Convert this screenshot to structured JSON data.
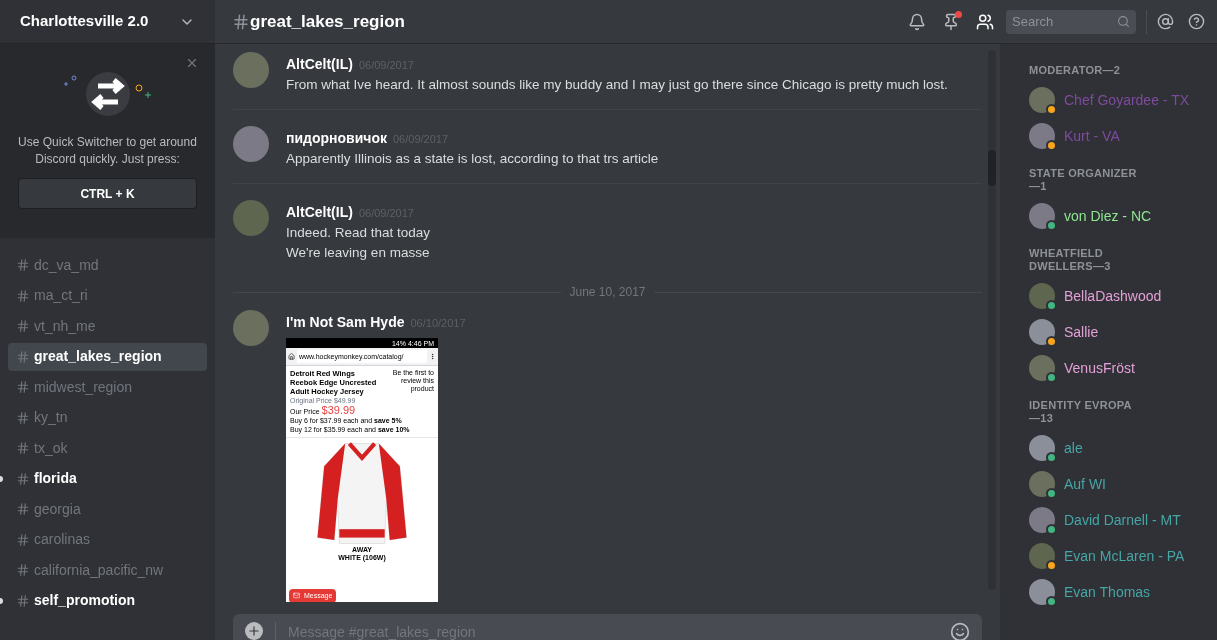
{
  "server": {
    "name": "Charlottesville 2.0"
  },
  "quick_switcher": {
    "text": "Use Quick Switcher to get around Discord quickly. Just press:",
    "shortcut": "CTRL + K"
  },
  "channels": [
    {
      "name": "dc_va_md",
      "selected": false,
      "unread": false
    },
    {
      "name": "ma_ct_ri",
      "selected": false,
      "unread": false
    },
    {
      "name": "vt_nh_me",
      "selected": false,
      "unread": false
    },
    {
      "name": "great_lakes_region",
      "selected": true,
      "unread": false
    },
    {
      "name": "midwest_region",
      "selected": false,
      "unread": false
    },
    {
      "name": "ky_tn",
      "selected": false,
      "unread": false
    },
    {
      "name": "tx_ok",
      "selected": false,
      "unread": false
    },
    {
      "name": "florida",
      "selected": false,
      "unread": true
    },
    {
      "name": "georgia",
      "selected": false,
      "unread": false
    },
    {
      "name": "carolinas",
      "selected": false,
      "unread": false
    },
    {
      "name": "california_pacific_nw",
      "selected": false,
      "unread": false
    },
    {
      "name": "self_promotion",
      "selected": false,
      "unread": true
    }
  ],
  "header": {
    "channel": "great_lakes_region",
    "search_placeholder": "Search",
    "pins_unread": true
  },
  "messages": [
    {
      "kind": "group",
      "author": "AltCelt(IL)",
      "time": "06/09/2017",
      "lines": [
        "From what Ive heard. It almost sounds like my buddy and I may just go there since Chicago is pretty much lost."
      ]
    },
    {
      "kind": "group",
      "author": "пидорновичок",
      "time": "06/09/2017",
      "lines": [
        "Apparently Illinois as a state is lost, according to that trs article"
      ]
    },
    {
      "kind": "group",
      "author": "AltCelt(IL)",
      "time": "06/09/2017",
      "lines": [
        "Indeed. Read that today",
        "We're leaving en masse"
      ]
    },
    {
      "kind": "date",
      "text": "June 10, 2017"
    },
    {
      "kind": "attachment",
      "author": "I'm Not Sam Hyde",
      "time": "06/10/2017",
      "shot": {
        "status": "14% 4:46 PM",
        "url": "www.hockeymonkey.com/catalog/",
        "title": "Detroit Red Wings Reebok Edge Uncrested Adult Hockey Jersey",
        "review": "Be the first to review this product",
        "original": "Original Price $49.99",
        "our_label": "Our Price",
        "price": "$39.99",
        "deals": [
          "Buy 6 for $37.99 each and **save 5%**",
          "Buy 12 for $35.99 each and **save 10%**"
        ],
        "caption": [
          "AWAY",
          "WHITE (106W)"
        ],
        "button": "Message"
      }
    }
  ],
  "composer": {
    "placeholder": "Message #great_lakes_region"
  },
  "member_groups": [
    {
      "title": "MODERATOR—2",
      "color": "#7e4a9e",
      "members": [
        {
          "name": "Chef Goyardee - TX",
          "idle": true
        },
        {
          "name": "Kurt - VA",
          "idle": true
        }
      ]
    },
    {
      "title": "STATE ORGANIZER—1",
      "color": "#8ee68e",
      "members": [
        {
          "name": "von Diez - NC",
          "idle": false
        }
      ]
    },
    {
      "title": "WHEATFIELD DWELLERS—3",
      "color": "#e3a0d6",
      "members": [
        {
          "name": "BellaDashwood",
          "idle": false
        },
        {
          "name": "Sallie",
          "idle": true
        },
        {
          "name": "VenusFröst",
          "idle": false
        }
      ]
    },
    {
      "title": "IDENTITY EVROPA—13",
      "color": "#46a5a5",
      "members": [
        {
          "name": "ale",
          "idle": false
        },
        {
          "name": "Auf WI",
          "idle": false
        },
        {
          "name": "David Darnell - MT",
          "idle": false
        },
        {
          "name": "Evan McLaren - PA",
          "idle": true
        },
        {
          "name": "Evan Thomas",
          "idle": false
        }
      ]
    }
  ]
}
